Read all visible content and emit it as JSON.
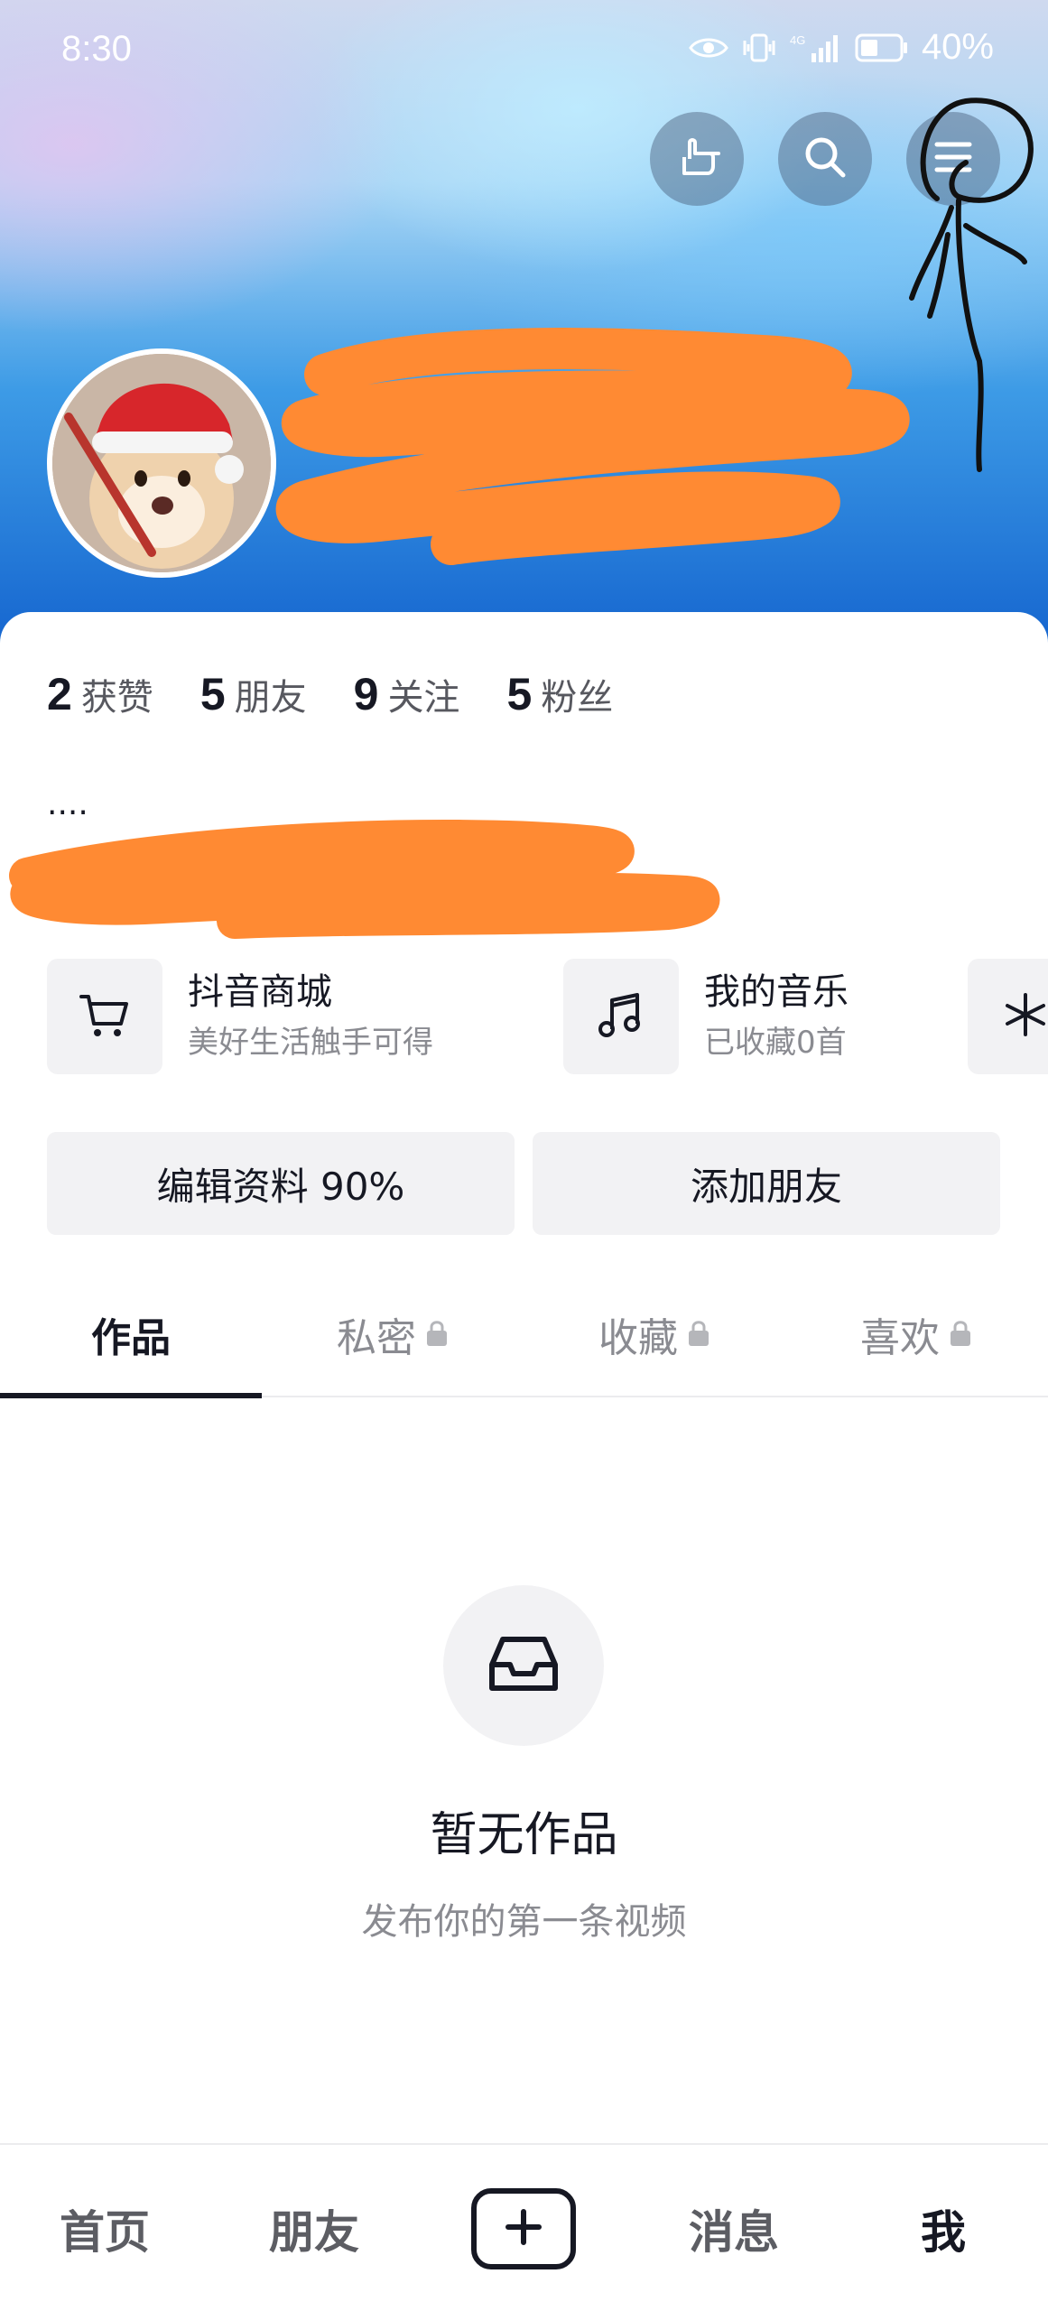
{
  "status_bar": {
    "time": "8:30",
    "network": "4G",
    "battery": "40%"
  },
  "header": {
    "icons": [
      "gesture-icon",
      "search-icon",
      "menu-icon"
    ]
  },
  "stats": [
    {
      "value": "2",
      "label": "获赞"
    },
    {
      "value": "5",
      "label": "朋友"
    },
    {
      "value": "9",
      "label": "关注"
    },
    {
      "value": "5",
      "label": "粉丝"
    }
  ],
  "bio": {
    "text": "...."
  },
  "services": [
    {
      "title": "抖音商城",
      "subtitle": "美好生活触手可得",
      "icon": "cart-icon"
    },
    {
      "title": "我的音乐",
      "subtitle": "已收藏0首",
      "icon": "music-icon"
    }
  ],
  "actions": {
    "edit_profile": "编辑资料 90%",
    "add_friends": "添加朋友"
  },
  "tabs": [
    {
      "label": "作品",
      "locked": false,
      "active": true
    },
    {
      "label": "私密",
      "locked": true,
      "active": false
    },
    {
      "label": "收藏",
      "locked": true,
      "active": false
    },
    {
      "label": "喜欢",
      "locked": true,
      "active": false
    }
  ],
  "empty_state": {
    "title": "暂无作品",
    "subtitle": "发布你的第一条视频",
    "icon": "inbox-icon"
  },
  "bottom_nav": {
    "home": "首页",
    "friends": "朋友",
    "add": "plus-icon",
    "messages": "消息",
    "me": "我"
  },
  "colors": {
    "text_primary": "#161823",
    "text_secondary": "#8a8b91",
    "button_bg": "#f2f2f4",
    "scribble_orange": "#ff8a33"
  }
}
